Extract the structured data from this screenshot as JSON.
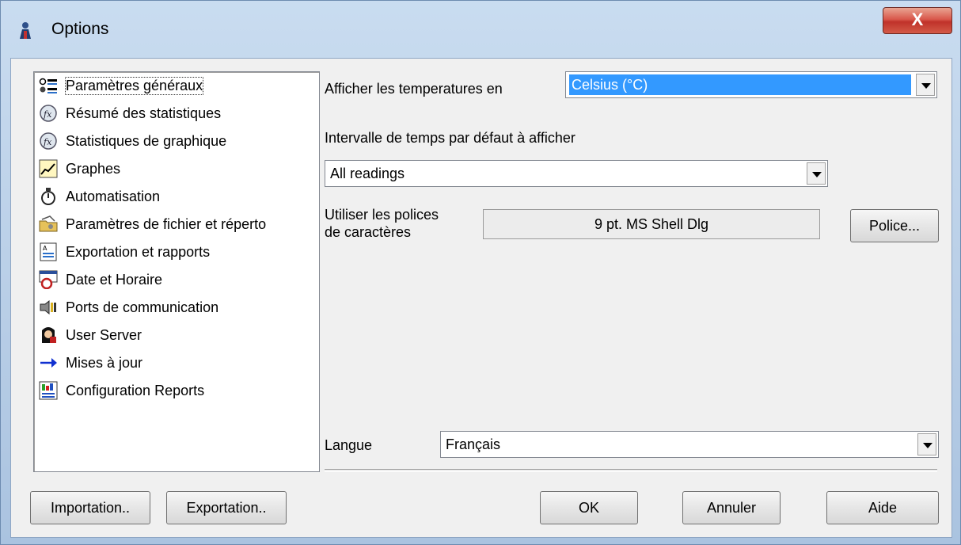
{
  "window": {
    "title": "Options",
    "close_label": "X"
  },
  "categories": [
    {
      "label": "Paramètres généraux",
      "icon": "settings-list-icon",
      "selected": true
    },
    {
      "label": "Résumé des statistiques",
      "icon": "statistics-function-icon"
    },
    {
      "label": "Statistiques de graphique",
      "icon": "graph-statistics-function-icon"
    },
    {
      "label": "Graphes",
      "icon": "line-graph-icon"
    },
    {
      "label": "Automatisation",
      "icon": "stopwatch-icon"
    },
    {
      "label": "Paramètres de fichier et réperto",
      "icon": "folder-settings-icon"
    },
    {
      "label": "Exportation et rapports",
      "icon": "export-report-icon"
    },
    {
      "label": "Date et Horaire",
      "icon": "calendar-clock-icon"
    },
    {
      "label": "Ports de communication",
      "icon": "communication-ports-icon"
    },
    {
      "label": "User Server",
      "icon": "user-server-icon"
    },
    {
      "label": "Mises à jour",
      "icon": "arrow-right-icon"
    },
    {
      "label": "Configuration Reports",
      "icon": "configuration-reports-icon"
    }
  ],
  "general": {
    "temperature_label": "Afficher les temperatures en",
    "temperature_value": "Celsius (°C)",
    "interval_label": "Intervalle de temps par défaut à afficher",
    "interval_value": "All readings",
    "font_label": "Utiliser les polices\nde caractères",
    "font_label_line1": "Utiliser les polices",
    "font_label_line2": "de caractères",
    "font_preview": "9 pt. MS Shell Dlg",
    "font_button": "Police...",
    "language_label": "Langue",
    "language_value": "Français"
  },
  "footer": {
    "import": "Importation..",
    "export": "Exportation..",
    "ok": "OK",
    "cancel": "Annuler",
    "help": "Aide"
  },
  "colors": {
    "selection": "#3399ff",
    "close_button": "#c7372e",
    "window_frame": "#b9cfe8"
  }
}
